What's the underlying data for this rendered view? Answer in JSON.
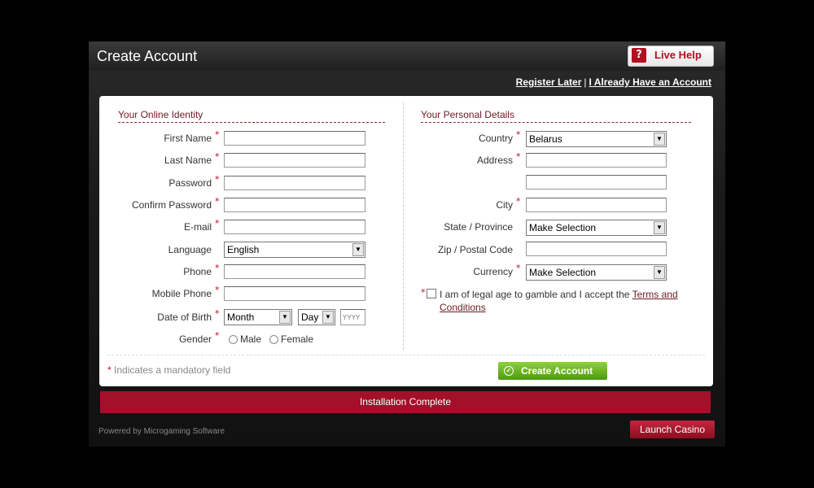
{
  "window": {
    "title": "Create Account"
  },
  "live_help": {
    "label": "Live Help",
    "icon": "help-question-icon"
  },
  "links": {
    "register_later": "Register Later",
    "separator": "|",
    "have_account": "I Already Have an Account"
  },
  "identity": {
    "title": "Your Online Identity",
    "first_name": {
      "label": "First Name",
      "value": ""
    },
    "last_name": {
      "label": "Last Name",
      "value": ""
    },
    "password": {
      "label": "Password",
      "value": ""
    },
    "confirm_password": {
      "label": "Confirm Password",
      "value": ""
    },
    "email": {
      "label": "E-mail",
      "value": ""
    },
    "language": {
      "label": "Language",
      "value": "English"
    },
    "phone": {
      "label": "Phone",
      "value": ""
    },
    "mobile_phone": {
      "label": "Mobile Phone",
      "value": ""
    },
    "dob": {
      "label": "Date of Birth",
      "month": "Month",
      "day": "Day",
      "year_placeholder": "YYYY"
    },
    "gender": {
      "label": "Gender",
      "male": "Male",
      "female": "Female"
    }
  },
  "personal": {
    "title": "Your Personal Details",
    "country": {
      "label": "Country",
      "value": "Belarus"
    },
    "address": {
      "label": "Address",
      "value": ""
    },
    "city": {
      "label": "City",
      "value": ""
    },
    "state": {
      "label": "State / Province",
      "value": "Make Selection"
    },
    "zip": {
      "label": "Zip / Postal Code",
      "value": ""
    },
    "currency": {
      "label": "Currency",
      "value": "Make Selection"
    },
    "terms": {
      "text": "I am of legal age to gamble and I accept the ",
      "link": "Terms and Conditions"
    }
  },
  "footer": {
    "required_star": "*",
    "mandatory_note": "Indicates a mandatory field",
    "create_button": "Create Account",
    "install_status": "Installation Complete",
    "powered_by": "Powered by Microgaming Software",
    "launch_button": "Launch Casino"
  },
  "colors": {
    "accent": "#a3102a",
    "section_title": "#6b1a22",
    "create_green": "#5aa61e"
  }
}
